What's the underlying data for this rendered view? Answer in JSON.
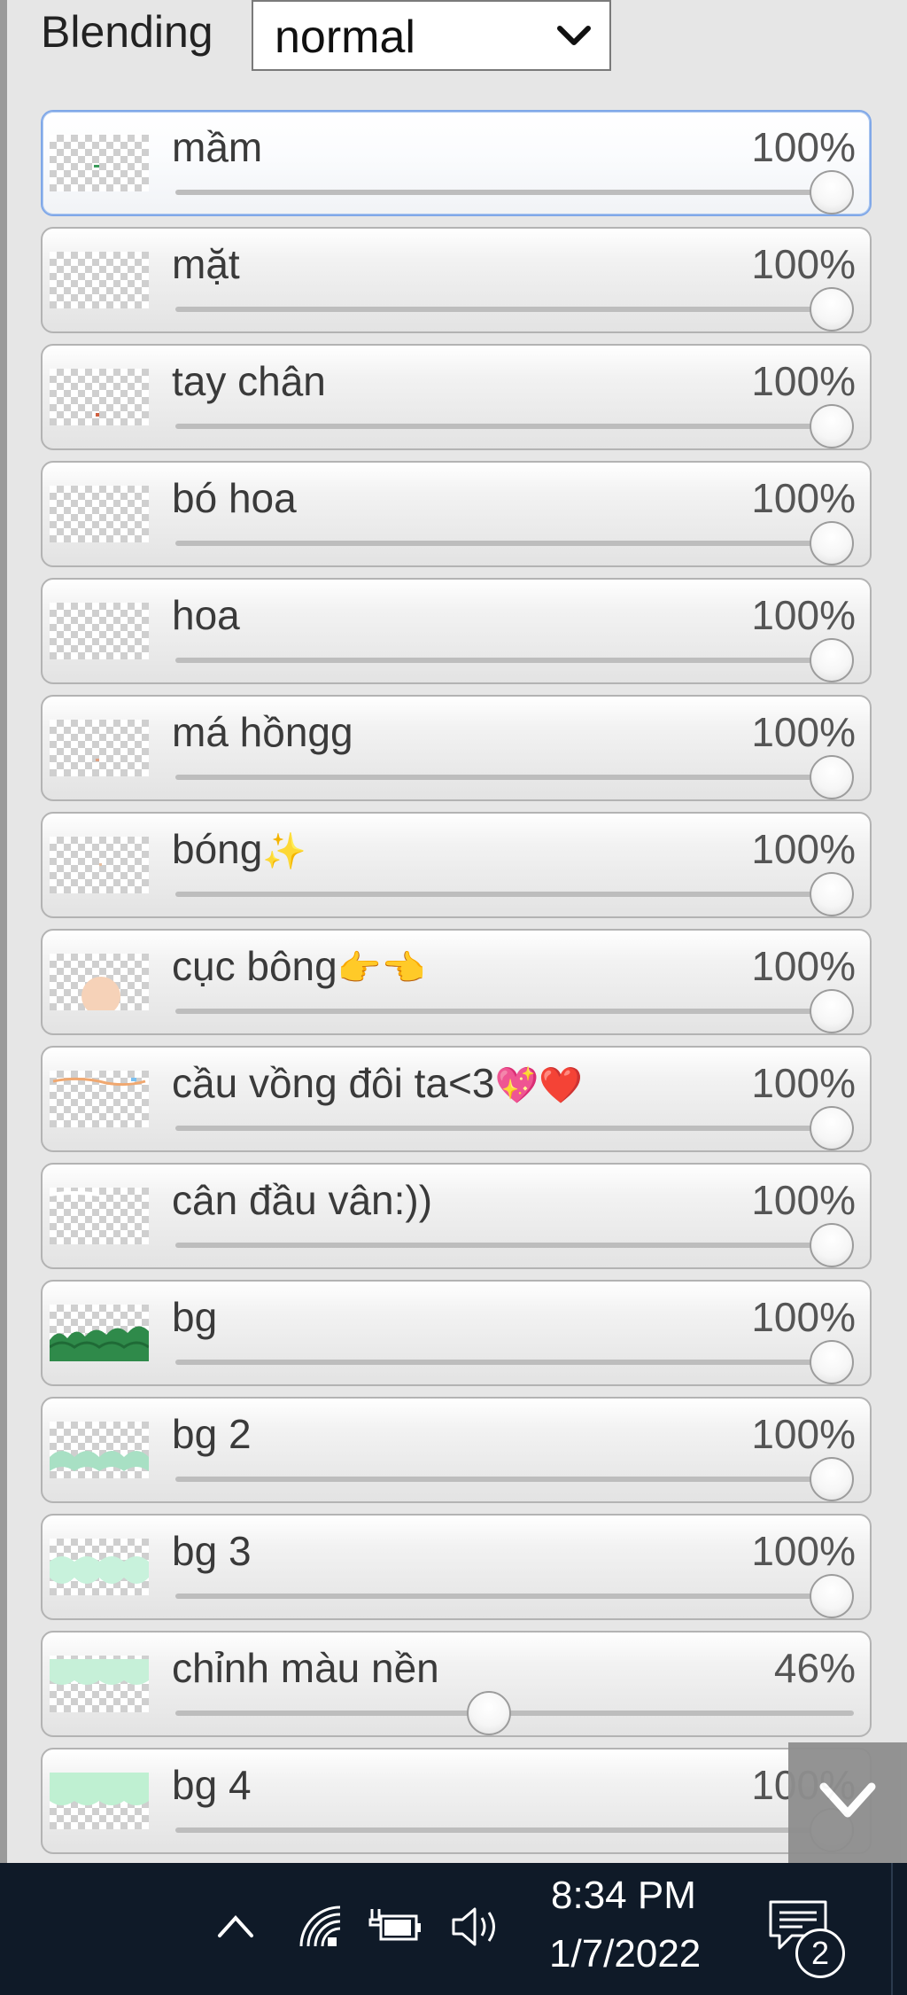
{
  "blending": {
    "label": "Blending",
    "value": "normal"
  },
  "layers": [
    {
      "name": "mầm",
      "opacity": "100%",
      "level": 100,
      "active": true
    },
    {
      "name": "mặt",
      "opacity": "100%",
      "level": 100
    },
    {
      "name": "tay chân",
      "opacity": "100%",
      "level": 100
    },
    {
      "name": "bó hoa",
      "opacity": "100%",
      "level": 100
    },
    {
      "name": "hoa",
      "opacity": "100%",
      "level": 100
    },
    {
      "name": "má hồngg",
      "opacity": "100%",
      "level": 100
    },
    {
      "name": "bóng",
      "emoji": "✨",
      "opacity": "100%",
      "level": 100
    },
    {
      "name": "cục bông",
      "emoji": "👉👈",
      "opacity": "100%",
      "level": 100
    },
    {
      "name": "cầu vồng đôi ta<3",
      "emoji": "💖❤️",
      "opacity": "100%",
      "level": 100
    },
    {
      "name": "cân đầu vân:))",
      "opacity": "100%",
      "level": 100
    },
    {
      "name": "bg",
      "opacity": "100%",
      "level": 100
    },
    {
      "name": "bg 2",
      "opacity": "100%",
      "level": 100
    },
    {
      "name": "bg 3",
      "opacity": "100%",
      "level": 100
    },
    {
      "name": "chỉnh màu nền",
      "opacity": "46%",
      "level": 46
    },
    {
      "name": "bg 4",
      "opacity": "100%",
      "level": 100
    }
  ],
  "taskbar": {
    "time": "8:34 PM",
    "date": "1/7/2022",
    "notification_count": "2",
    "icons": [
      "chevron-up-icon",
      "wifi-icon",
      "battery-icon",
      "volume-icon",
      "notification-icon"
    ]
  },
  "colors": {
    "active_border": "#80a8e8",
    "taskbar_bg": "#0f1a28"
  }
}
